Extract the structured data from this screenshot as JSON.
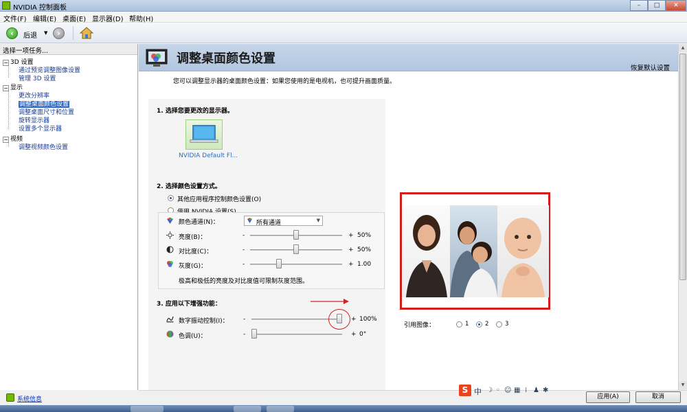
{
  "window": {
    "title": "NVIDIA 控制面板",
    "min": "–",
    "max": "□",
    "close": "✕"
  },
  "menu": [
    "文件(F)",
    "编辑(E)",
    "桌面(E)",
    "显示器(D)",
    "帮助(H)"
  ],
  "toolbar": {
    "back_label": "后退"
  },
  "taskpane": {
    "header": "选择一项任务...",
    "groups": [
      {
        "label": "3D 设置",
        "items": [
          "通过预览调整图像设置",
          "管理 3D 设置"
        ]
      },
      {
        "label": "显示",
        "items": [
          "更改分辨率",
          "调整桌面颜色设置",
          "调整桌面尺寸和位置",
          "旋转显示器",
          "设置多个显示器"
        ]
      },
      {
        "label": "视频",
        "items": [
          "调整视频颜色设置"
        ]
      }
    ],
    "selected_item": "调整桌面颜色设置",
    "system_info": "系统信息"
  },
  "main": {
    "title": "调整桌面颜色设置",
    "restore_defaults": "恢复默认设置",
    "description": "您可以调整显示器的桌面颜色设置：如果您使用的是电视机，也可提升画面质量。",
    "section1": {
      "title": "1. 选择您要更改的显示器。",
      "monitor_label": "NVIDIA Default Fl..."
    },
    "section2": {
      "title": "2. 选择颜色设置方式。",
      "option_app": "其他应用程序控制颜色设置(O)",
      "option_nvidia": "使用 NVIDIA 设置(S)",
      "selected": "option_app",
      "channel_label": "颜色通道(N)：",
      "channel_value": "所有通道",
      "brightness": {
        "label": "亮度(B)：",
        "min": "-",
        "max": "+",
        "value": "50%",
        "level": 0.5
      },
      "contrast": {
        "label": "对比度(C)：",
        "min": "-",
        "max": "+",
        "value": "50%",
        "level": 0.5
      },
      "gamma": {
        "label": "灰度(G)：",
        "min": "-",
        "max": "+",
        "value": "1.00",
        "level": 0.3
      },
      "note": "极高和极低的亮度及对比度值可限制灰度范围。"
    },
    "section3": {
      "title": "3. 应用以下增强功能：",
      "vibrance": {
        "label": "数字振动控制(I)：",
        "min": "-",
        "max": "+",
        "value": "100%",
        "level": 1.0
      },
      "hue": {
        "label": "色调(U)：",
        "min": "-",
        "max": "+",
        "value": "0°",
        "level": 0.0
      }
    },
    "reference": {
      "label": "引用图像：",
      "options": [
        "1",
        "2",
        "3"
      ],
      "selected": "2"
    }
  },
  "buttons": {
    "apply": "应用(A)",
    "cancel": "取消"
  },
  "ime": {
    "logo": "S",
    "lang": "中"
  },
  "colors": {
    "accent_red": "#d31c1c",
    "nvidia_green": "#76b900",
    "selection_blue": "#3169c6"
  }
}
